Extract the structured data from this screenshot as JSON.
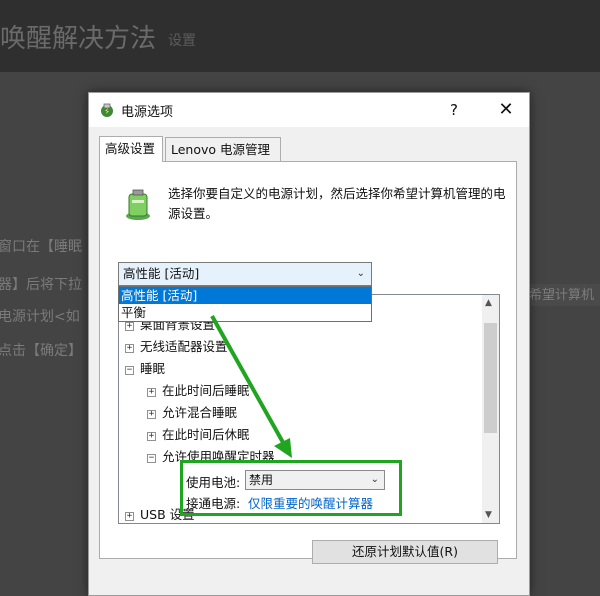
{
  "background": {
    "title": "唤醒解决方法",
    "extra": "设置",
    "lines": [
      "窗口在【睡眠",
      "器】后将下拉",
      "电源计划<如",
      "点击【确定】"
    ],
    "right_fragment": "你希望计算机"
  },
  "dialog": {
    "title": "电源选项",
    "help": "?",
    "close": "✕",
    "tabs": [
      "高级设置",
      "Lenovo 电源管理"
    ],
    "description": "选择你要自定义的电源计划，然后选择你希望计算机管理的电源设置。",
    "plan_select": {
      "value": "高性能 [活动]",
      "options": [
        "高性能 [活动]",
        "平衡"
      ]
    },
    "tree": [
      {
        "label": "桌面背景设置",
        "expander": "+"
      },
      {
        "label": "无线适配器设置",
        "expander": "+"
      },
      {
        "label": "睡眠",
        "expander": "−"
      },
      {
        "label": "在此时间后睡眠",
        "expander": "+"
      },
      {
        "label": "允许混合睡眠",
        "expander": "+"
      },
      {
        "label": "在此时间后休眠",
        "expander": "+"
      },
      {
        "label": "允许使用唤醒定时器",
        "expander": "−"
      },
      {
        "label": "USB 设置",
        "expander": "+"
      }
    ],
    "settings": {
      "battery_label": "使用电池:",
      "battery_value": "禁用",
      "plugged_label": "接通电源:",
      "plugged_value": "仅限重要的唤醒计算器"
    },
    "restore_button": "还原计划默认值(R)"
  },
  "colors": {
    "highlight": "#0078d7",
    "annotation": "#1fa51f",
    "link": "#0066cc"
  }
}
